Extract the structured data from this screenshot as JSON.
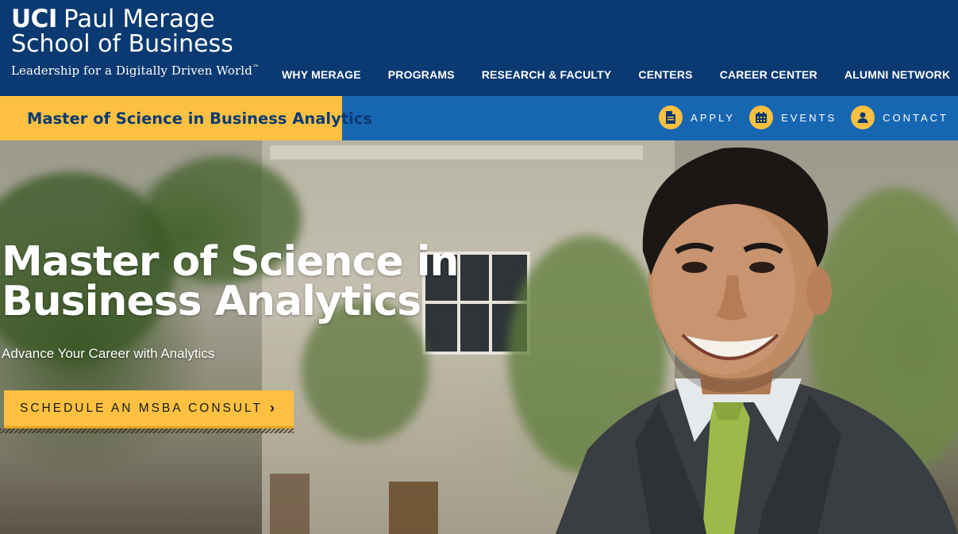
{
  "header": {
    "logo": {
      "brand": "UCI",
      "line1": "Paul Merage",
      "line2": "School of Business",
      "tagline": "Leadership for a Digitally Driven World",
      "trademark": "™"
    },
    "nav": [
      {
        "label": "WHY MERAGE"
      },
      {
        "label": "PROGRAMS"
      },
      {
        "label": "RESEARCH & FACULTY"
      },
      {
        "label": "CENTERS"
      },
      {
        "label": "CAREER CENTER"
      },
      {
        "label": "ALUMNI NETWORK"
      }
    ]
  },
  "subbar": {
    "program_title": "Master of Science in Business Analytics",
    "menu_icon": "hamburger-icon",
    "utility": [
      {
        "label": "APPLY",
        "icon": "document-icon"
      },
      {
        "label": "EVENTS",
        "icon": "calendar-icon"
      },
      {
        "label": "CONTACT",
        "icon": "person-icon"
      }
    ]
  },
  "hero": {
    "title_line1": "Master of Science in",
    "title_line2": "Business Analytics",
    "subtitle": "Advance Your Career with Analytics",
    "cta_label": "SCHEDULE AN MSBA CONSULT",
    "cta_icon": "chevron-right-icon"
  },
  "colors": {
    "navy": "#0b3a72",
    "blue": "#1766b2",
    "gold": "#fdc040"
  }
}
